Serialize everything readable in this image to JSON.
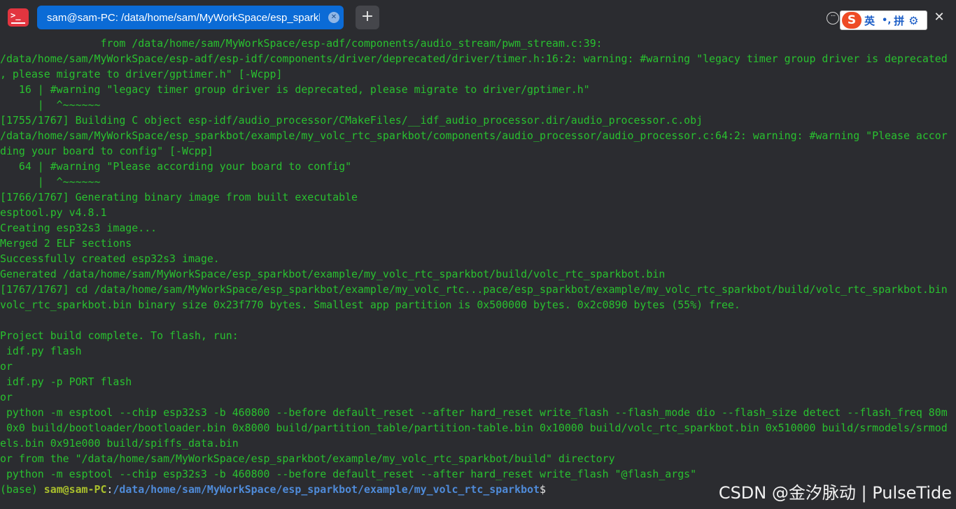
{
  "window": {
    "tab_title": "sam@sam-PC: /data/home/sam/MyWorkSpace/esp_sparkbo···",
    "tab_close_glyph": "✕",
    "new_tab_glyph": "+",
    "more_glyph": "···",
    "close_glyph": "✕",
    "app_icon_glyph": ">_",
    "icons": [
      "terminal-app-icon",
      "tab-close-icon",
      "plus-icon",
      "more-icon",
      "close-icon"
    ]
  },
  "ime": {
    "logo": "S",
    "mode": "英",
    "punct": "•,",
    "pinyin": "拼",
    "gear": "⚙"
  },
  "terminal": {
    "lines": [
      "                from /data/home/sam/MyWorkSpace/esp-adf/components/audio_stream/pwm_stream.c:39:",
      "/data/home/sam/MyWorkSpace/esp-adf/esp-idf/components/driver/deprecated/driver/timer.h:16:2: warning: #warning \"legacy timer group driver is deprecated",
      ", please migrate to driver/gptimer.h\" [-Wcpp]",
      "   16 | #warning \"legacy timer group driver is deprecated, please migrate to driver/gptimer.h\"",
      "      |  ^~~~~~~",
      "[1755/1767] Building C object esp-idf/audio_processor/CMakeFiles/__idf_audio_processor.dir/audio_processor.c.obj",
      "/data/home/sam/MyWorkSpace/esp_sparkbot/example/my_volc_rtc_sparkbot/components/audio_processor/audio_processor.c:64:2: warning: #warning \"Please accor",
      "ding your board to config\" [-Wcpp]",
      "   64 | #warning \"Please according your board to config\"",
      "      |  ^~~~~~~",
      "[1766/1767] Generating binary image from built executable",
      "esptool.py v4.8.1",
      "Creating esp32s3 image...",
      "Merged 2 ELF sections",
      "Successfully created esp32s3 image.",
      "Generated /data/home/sam/MyWorkSpace/esp_sparkbot/example/my_volc_rtc_sparkbot/build/volc_rtc_sparkbot.bin",
      "[1767/1767] cd /data/home/sam/MyWorkSpace/esp_sparkbot/example/my_volc_rtc...pace/esp_sparkbot/example/my_volc_rtc_sparkbot/build/volc_rtc_sparkbot.bin",
      "volc_rtc_sparkbot.bin binary size 0x23f770 bytes. Smallest app partition is 0x500000 bytes. 0x2c0890 bytes (55%) free.",
      "",
      "Project build complete. To flash, run:",
      " idf.py flash",
      "or",
      " idf.py -p PORT flash",
      "or",
      " python -m esptool --chip esp32s3 -b 460800 --before default_reset --after hard_reset write_flash --flash_mode dio --flash_size detect --flash_freq 80m",
      " 0x0 build/bootloader/bootloader.bin 0x8000 build/partition_table/partition-table.bin 0x10000 build/volc_rtc_sparkbot.bin 0x510000 build/srmodels/srmod",
      "els.bin 0x91e000 build/spiffs_data.bin",
      "or from the \"/data/home/sam/MyWorkSpace/esp_sparkbot/example/my_volc_rtc_sparkbot/build\" directory",
      " python -m esptool --chip esp32s3 -b 460800 --before default_reset --after hard_reset write_flash \"@flash_args\""
    ],
    "prompt": {
      "env": "(base) ",
      "user": "sam@sam-PC",
      "sep": ":",
      "path": "/data/home/sam/MyWorkSpace/esp_sparkbot/example/my_volc_rtc_sparkbot",
      "dollar": "$"
    },
    "colors": {
      "background": "#2b2c30",
      "text": "#29c12f",
      "user": "#aac02c",
      "path": "#4f8bd9",
      "tab_active": "#0b6bd6"
    }
  },
  "watermark": "CSDN @金汐脉动 | PulseTide"
}
